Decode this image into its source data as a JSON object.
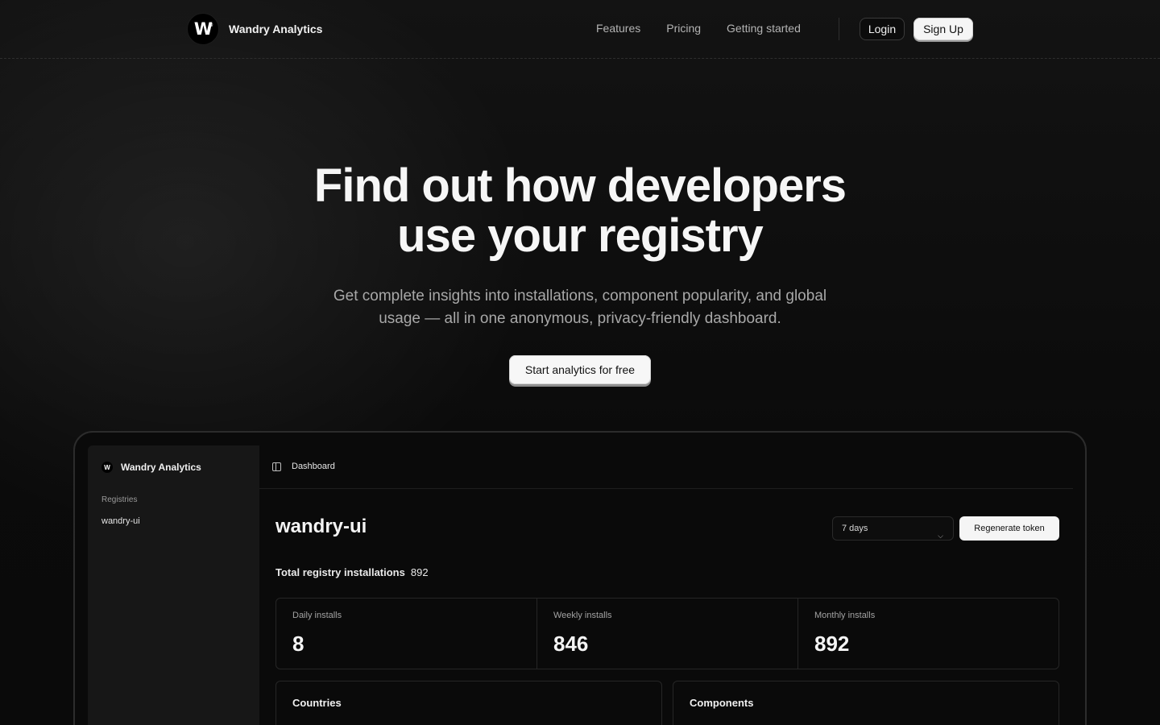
{
  "nav": {
    "brand": "Wandry Analytics",
    "logo_letter": "W",
    "links": [
      "Features",
      "Pricing",
      "Getting started"
    ],
    "login_label": "Login",
    "signup_label": "Sign Up"
  },
  "hero": {
    "title_line1": "Find out how developers",
    "title_line2": "use your registry",
    "subtitle_line1": "Get complete insights into installations, component popularity, and global",
    "subtitle_line2": "usage — all in one anonymous, privacy-friendly dashboard.",
    "cta_label": "Start analytics for free"
  },
  "dashboard": {
    "sidebar": {
      "brand": "Wandry Analytics",
      "logo_letter": "W",
      "section_label": "Registries",
      "items": [
        "wandry-ui"
      ]
    },
    "breadcrumb": "Dashboard",
    "registry_name": "wandry-ui",
    "range_select": "7 days",
    "regenerate_label": "Regenerate token",
    "total_label": "Total registry installations",
    "total_value": "892",
    "stats": [
      {
        "label": "Daily installs",
        "value": "8"
      },
      {
        "label": "Weekly installs",
        "value": "846"
      },
      {
        "label": "Monthly installs",
        "value": "892"
      }
    ],
    "cards": [
      "Countries",
      "Components"
    ]
  }
}
